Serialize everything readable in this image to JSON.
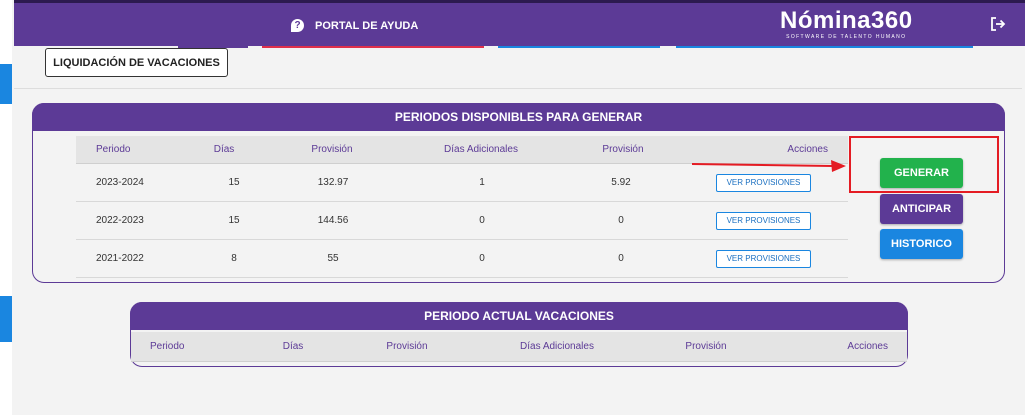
{
  "topbar": {
    "help_label": "PORTAL DE AYUDA",
    "brand_name": "Nómina360",
    "brand_tagline": "SOFTWARE DE TALENTO HUMANO"
  },
  "colors": {
    "primary": "#5c3a96",
    "green": "#22b24c",
    "blue": "#1a86e0",
    "red": "#e41b23"
  },
  "liquidacion_label": "LIQUIDACIÓN DE VACACIONES",
  "available": {
    "title": "PERIODOS DISPONIBLES PARA GENERAR",
    "headers": [
      "Periodo",
      "Días",
      "Provisión",
      "Días Adicionales",
      "Provisión",
      "Acciones"
    ],
    "rows": [
      {
        "periodo": "2023-2024",
        "dias": "15",
        "provision": "132.97",
        "dias_adicionales": "1",
        "provision_adicional": "5.92",
        "action": "VER PROVISIONES"
      },
      {
        "periodo": "2022-2023",
        "dias": "15",
        "provision": "144.56",
        "dias_adicionales": "0",
        "provision_adicional": "0",
        "action": "VER PROVISIONES"
      },
      {
        "periodo": "2021-2022",
        "dias": "8",
        "provision": "55",
        "dias_adicionales": "0",
        "provision_adicional": "0",
        "action": "VER PROVISIONES"
      }
    ]
  },
  "buttons": {
    "generar": "GENERAR",
    "anticipar": "ANTICIPAR",
    "historico": "HISTORICO"
  },
  "current": {
    "title": "PERIODO ACTUAL VACACIONES",
    "headers": [
      "Periodo",
      "Días",
      "Provisión",
      "Días Adicionales",
      "Provisión",
      "Acciones"
    ]
  }
}
